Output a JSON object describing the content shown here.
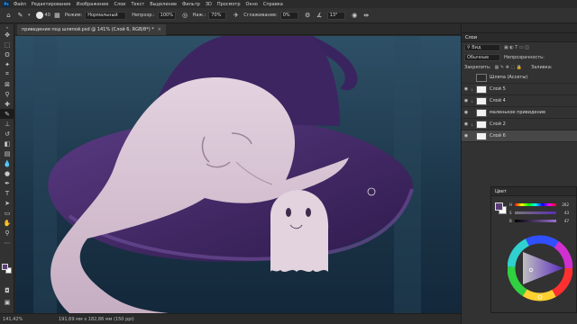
{
  "menubar": {
    "items": [
      "Файл",
      "Редактирование",
      "Изображение",
      "Слои",
      "Текст",
      "Выделение",
      "Фильтр",
      "3D",
      "Просмотр",
      "Окно",
      "Справка"
    ]
  },
  "options": {
    "brush_size": "40",
    "mode_label": "Режим:",
    "mode_value": "Нормальный",
    "opacity_label": "Непрозр.:",
    "opacity_value": "100%",
    "flow_label": "Наж.:",
    "flow_value": "70%",
    "smoothing_label": "Сглаживание:",
    "smoothing_value": "0%",
    "angle_value": "13°"
  },
  "document": {
    "tab_title": "приведения под шляпой.psd @ 141% (Слой 6, RGB/8*) *",
    "close": "×"
  },
  "status": {
    "zoom": "141,42%",
    "size": "191,69 мм x 182,86 мм (150 ppi)"
  },
  "layers_panel": {
    "title": "Слои",
    "kind_label": "Вид",
    "blend_mode": "Обычные",
    "opacity_label": "Непрозрачность:",
    "lock_label": "Закрепить:",
    "fill_label": "Заливка:",
    "layers": [
      {
        "name": "Шляпа (Ассеты)",
        "visible": false,
        "fx": true
      },
      {
        "name": "Слой 5",
        "visible": true,
        "fx": false
      },
      {
        "name": "Слой 4",
        "visible": true,
        "fx": false
      },
      {
        "name": "маленькое привидение",
        "visible": true,
        "fx": false
      },
      {
        "name": "Слой 2",
        "visible": true,
        "fx": false
      },
      {
        "name": "Слой 6",
        "visible": true,
        "fx": false,
        "selected": true
      }
    ]
  },
  "color_panel": {
    "title": "Цвет",
    "sliders": [
      {
        "label": "H",
        "value": "262"
      },
      {
        "label": "S",
        "value": "43"
      },
      {
        "label": "B",
        "value": "47"
      }
    ]
  },
  "colors": {
    "foreground": "#5a3d78",
    "background": "#ffffff",
    "canvas_bg": "#1c3a4e",
    "hat": "#4a2e6e",
    "ghost": "#d9c6d4"
  }
}
